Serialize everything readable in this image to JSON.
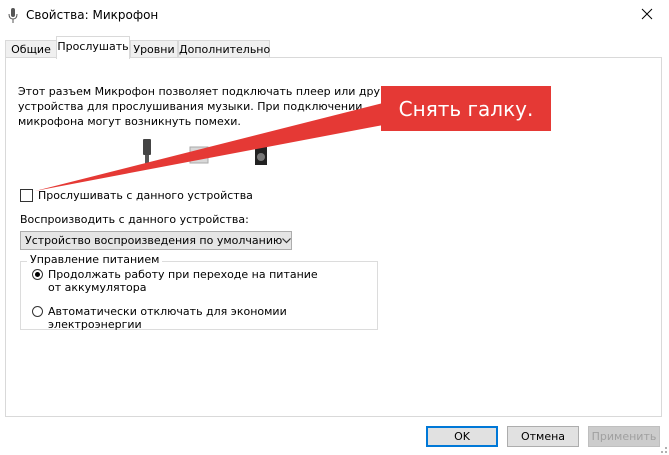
{
  "window": {
    "title": "Свойства: Микрофон",
    "title_icon": "microphone-icon",
    "close_icon": "close-icon"
  },
  "tabs": [
    {
      "label": "Общие",
      "active": false
    },
    {
      "label": "Прослушать",
      "active": true
    },
    {
      "label": "Уровни",
      "active": false
    },
    {
      "label": "Дополнительно",
      "active": false
    }
  ],
  "listen_tab": {
    "description_lines": [
      "Этот разъем Микрофон позволяет подключать плеер или другие",
      "устройства для прослушивания музыки. При подключении",
      "микрофона могут возникнуть помехи."
    ],
    "listen_checkbox": {
      "label": "Прослушивать с данного устройства",
      "checked": false
    },
    "playback_label": "Воспроизводить с данного устройства:",
    "playback_select": {
      "value": "Устройство воспроизведения по умолчанию"
    },
    "power_group": {
      "title": "Управление питанием",
      "options": [
        {
          "label": "Продолжать работу при переходе на питание от аккумулятора",
          "selected": true
        },
        {
          "label": "Автоматически отключать для экономии электроэнергии",
          "selected": false
        }
      ]
    }
  },
  "annotation": {
    "text": "Снять галку.",
    "color": "#e53935"
  },
  "buttons": {
    "ok": "OK",
    "cancel": "Отмена",
    "apply": "Применить"
  },
  "colors": {
    "accent": "#0078d7",
    "callout": "#e53935"
  }
}
